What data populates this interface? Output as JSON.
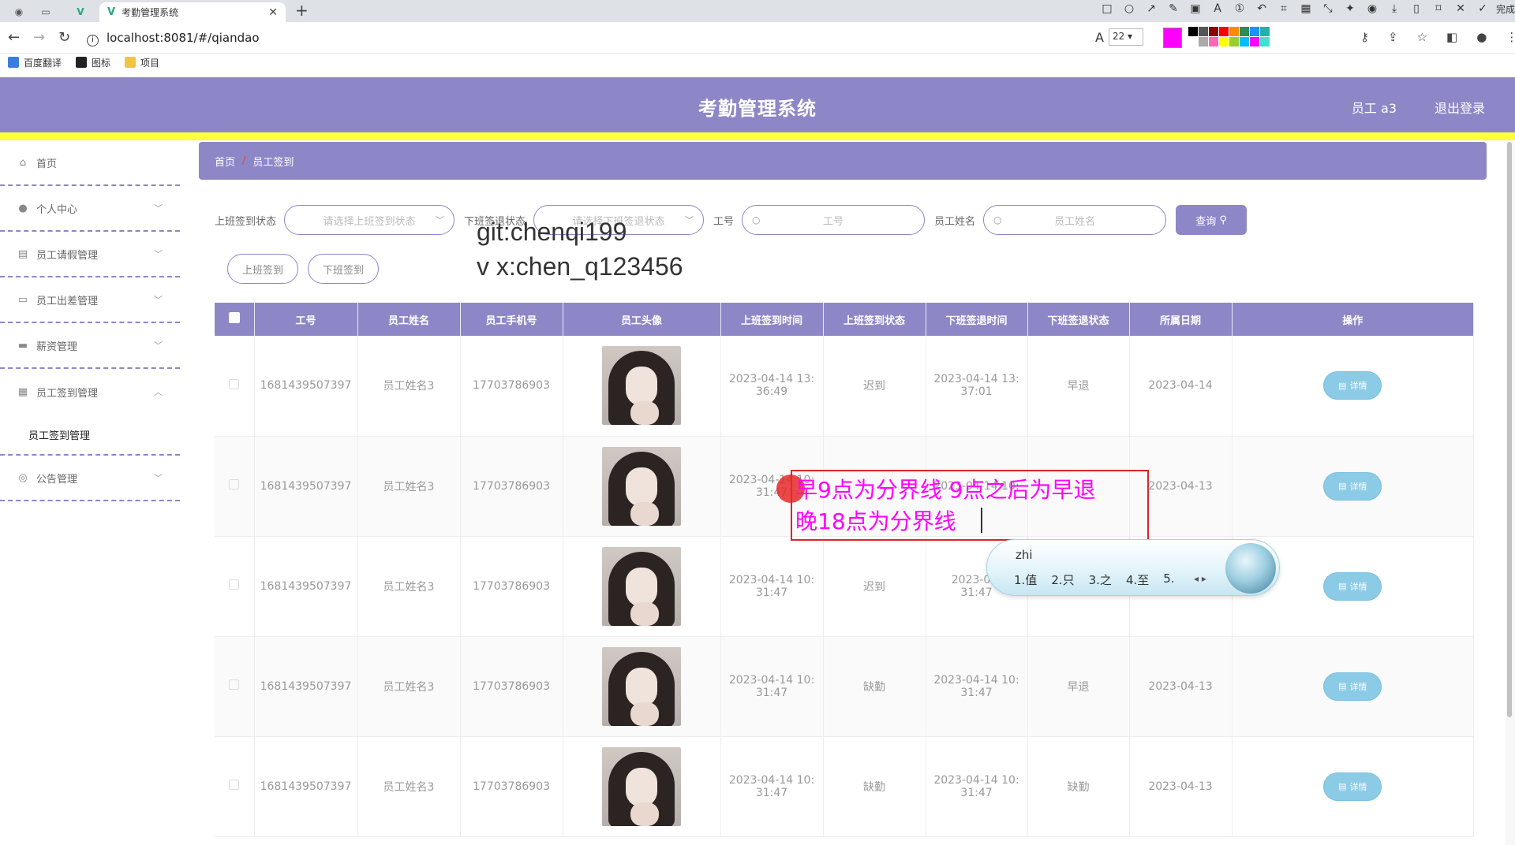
{
  "browser": {
    "tab_title": "考勤管理系统",
    "url": "localhost:8081/#/qiandao",
    "font_size": "22",
    "done_label": "完成",
    "bookmarks": [
      "百度翻译",
      "图标",
      "项目"
    ],
    "pen_color": "#ff00ff",
    "palette": [
      "#000000",
      "#555555",
      "#8b0000",
      "#ff0000",
      "#ff8c00",
      "#2e8b57",
      "#1e90ff",
      "#20b2aa",
      "#ffffff",
      "#aaaaaa",
      "#ff69b4",
      "#ffff00",
      "#9acd32",
      "#00bfff",
      "#ff00ff",
      "#40e0d0"
    ]
  },
  "header": {
    "title": "考勤管理系统",
    "user": "员工 a3",
    "logout": "退出登录"
  },
  "sidebar": {
    "items": [
      {
        "label": "首页",
        "icon": "home-icon",
        "glyph": "⌂"
      },
      {
        "label": "个人中心",
        "icon": "user-icon",
        "glyph": "●"
      },
      {
        "label": "员工请假管理",
        "icon": "chart-icon",
        "glyph": "▤"
      },
      {
        "label": "员工出差管理",
        "icon": "chat-icon",
        "glyph": "▭"
      },
      {
        "label": "薪资管理",
        "icon": "monitor-icon",
        "glyph": "▬"
      },
      {
        "label": "员工签到管理",
        "icon": "grid-icon",
        "glyph": "▦"
      },
      {
        "label": "公告管理",
        "icon": "compass-icon",
        "glyph": "◎"
      }
    ],
    "sub_item": "员工签到管理"
  },
  "breadcrumb": {
    "home": "首页",
    "current": "员工签到"
  },
  "filters": {
    "checkin_status_label": "上班签到状态",
    "checkin_status_placeholder": "请选择上班签到状态",
    "checkout_status_label": "下班签退状态",
    "checkout_status_placeholder": "请选择下班签退状态",
    "id_label": "工号",
    "id_placeholder": "工号",
    "name_label": "员工姓名",
    "name_placeholder": "员工姓名",
    "search_button": "查询"
  },
  "actions": {
    "checkin": "上班签到",
    "checkout": "下班签到"
  },
  "watermark": {
    "line1": "git:chenqi199",
    "line2": "v x:chen_q123456"
  },
  "table": {
    "columns": [
      "工号",
      "员工姓名",
      "员工手机号",
      "员工头像",
      "上班签到时间",
      "上班签到状态",
      "下班签退时间",
      "下班签退状态",
      "所属日期",
      "操作"
    ],
    "detail_label": "详情",
    "rows": [
      {
        "id": "1681439507397",
        "name": "员工姓名3",
        "phone": "17703786903",
        "in_time_a": "2023-04-14 13:",
        "in_time_b": "36:49",
        "in_status": "迟到",
        "out_time_a": "2023-04-14 13:",
        "out_time_b": "37:01",
        "out_status": "早退",
        "date": "2023-04-14"
      },
      {
        "id": "1681439507397",
        "name": "员工姓名3",
        "phone": "17703786903",
        "in_time_a": "2023-04-14 10:",
        "in_time_b": "31:47",
        "in_status": "",
        "out_time_a": "2023-04-14 10:",
        "out_time_b": "",
        "out_status": "",
        "date": "2023-04-13"
      },
      {
        "id": "1681439507397",
        "name": "员工姓名3",
        "phone": "17703786903",
        "in_time_a": "2023-04-14 10:",
        "in_time_b": "31:47",
        "in_status": "迟到",
        "out_time_a": "2023-04-",
        "out_time_b": "31:47",
        "out_status": "",
        "date": ""
      },
      {
        "id": "1681439507397",
        "name": "员工姓名3",
        "phone": "17703786903",
        "in_time_a": "2023-04-14 10:",
        "in_time_b": "31:47",
        "in_status": "缺勤",
        "out_time_a": "2023-04-14 10:",
        "out_time_b": "31:47",
        "out_status": "早退",
        "date": "2023-04-13"
      },
      {
        "id": "1681439507397",
        "name": "员工姓名3",
        "phone": "17703786903",
        "in_time_a": "2023-04-14 10:",
        "in_time_b": "31:47",
        "in_status": "缺勤",
        "out_time_a": "2023-04-14 10:",
        "out_time_b": "31:47",
        "out_status": "缺勤",
        "date": "2023-04-13"
      }
    ]
  },
  "annotation": {
    "line1": "早9点为分界线 9点之后为早退",
    "line2": "晚18点为分界线"
  },
  "ime": {
    "composition": "zhi",
    "candidates": [
      "1.值",
      "2.只",
      "3.之",
      "4.至",
      "5."
    ]
  }
}
